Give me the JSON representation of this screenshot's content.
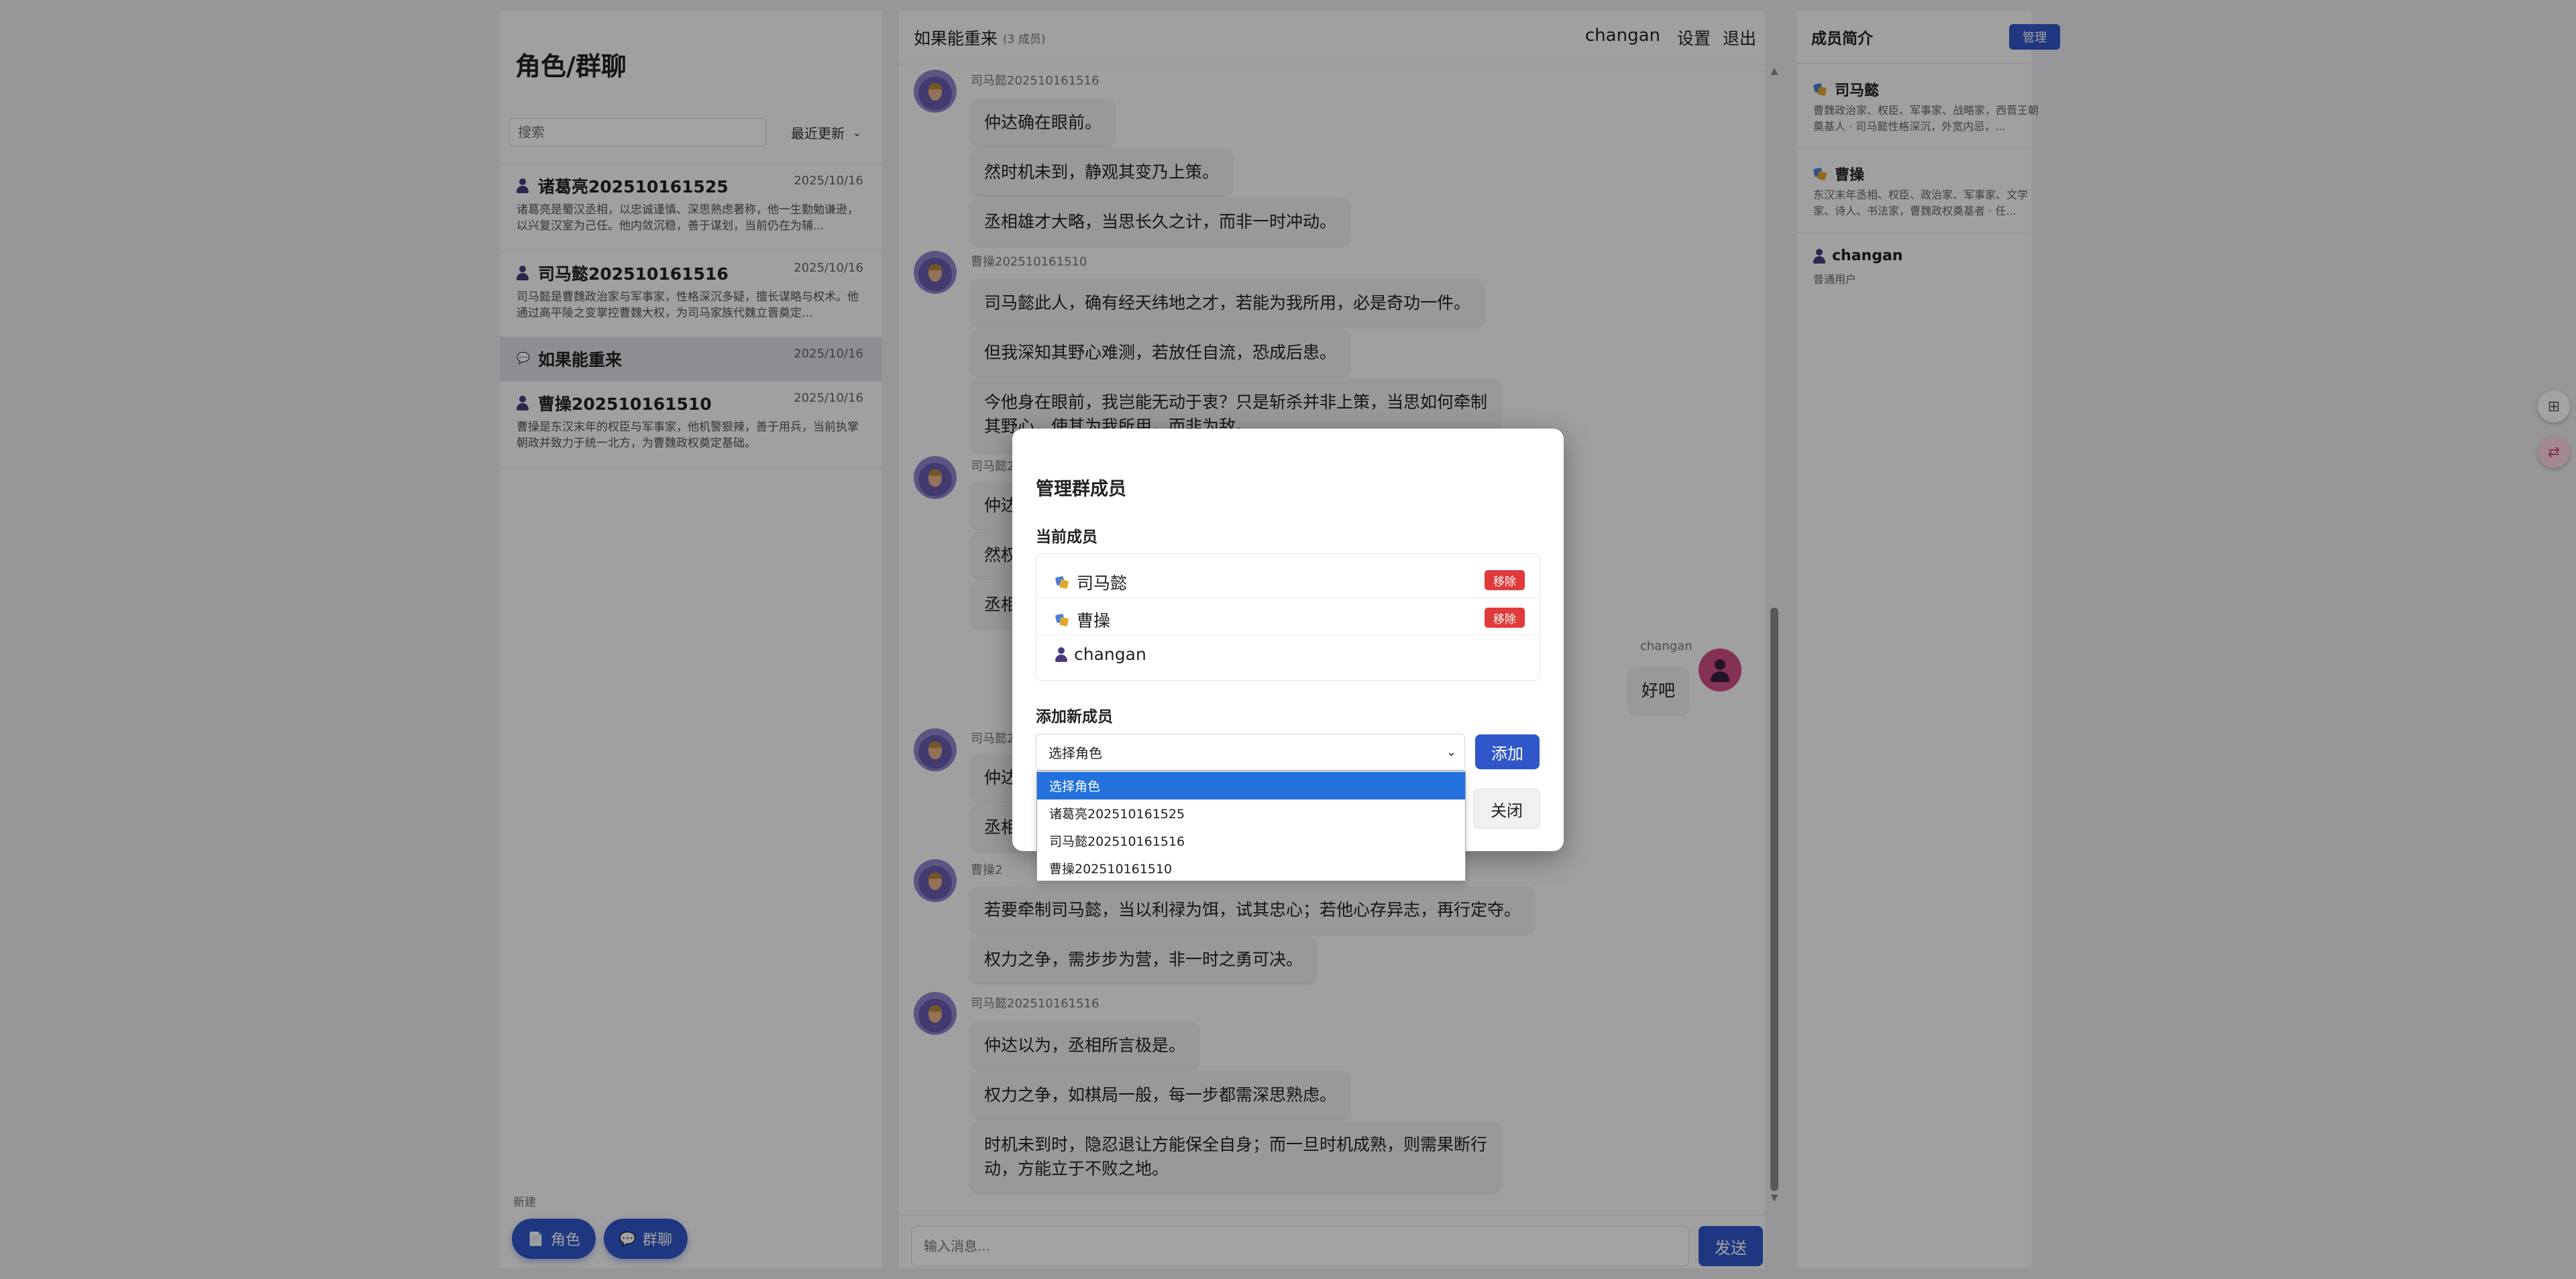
{
  "left_panel": {
    "title": "角色/群聊",
    "search_placeholder": "搜索",
    "sort_label": "最近更新",
    "conversations": [
      {
        "name": "诸葛亮202510161525",
        "date": "2025/10/16",
        "preview": "诸葛亮是蜀汉丞相，以忠诚谨慎、深思熟虑著称，他一生勤勉谦逊，以兴复汉室为己任。他内敛沉稳，善于谋划，当前仍在为辅..."
      },
      {
        "name": "司马懿202510161516",
        "date": "2025/10/16",
        "preview": "司马懿是曹魏政治家与军事家，性格深沉多疑，擅长谋略与权术。他通过高平陵之变掌控曹魏大权，为司马家族代魏立晋奠定..."
      },
      {
        "name": "如果能重来",
        "date": "2025/10/16",
        "preview": ""
      },
      {
        "name": "曹操202510161510",
        "date": "2025/10/16",
        "preview": "曹操是东汉末年的权臣与军事家，他机警狠辣，善于用兵，当前执掌朝政并致力于统一北方，为曹魏政权奠定基础。"
      }
    ],
    "new_label": "新建",
    "new_role_button": "角色",
    "new_group_button": "群聊"
  },
  "chat": {
    "title": "如果能重来",
    "member_count": "(3 成员)",
    "user": "changan",
    "settings": "设置",
    "logout": "退出",
    "messages": [
      {
        "sender": "司马懿202510161516",
        "lines": [
          "仲达确在眼前。",
          "然时机未到，静观其变乃上策。",
          "丞相雄才大略，当思长久之计，而非一时冲动。"
        ]
      },
      {
        "sender": "曹操202510161510",
        "lines": [
          "司马懿此人，确有经天纬地之才，若能为我所用，必是奇功一件。",
          "但我深知其野心难测，若放任自流，恐成后患。",
          "今他身在眼前，我岂能无动于衷？只是斩杀并非上策，当思如何牵制其野心，使其为我所用，而非为敌。"
        ]
      },
      {
        "sender": "司马懿2",
        "lines": [
          "仲达",
          "然权",
          "丞相"
        ]
      },
      {
        "sender": "changan",
        "lines": [
          "好吧"
        ]
      },
      {
        "sender": "司马懿2",
        "lines": [
          "仲达",
          "丞相"
        ]
      },
      {
        "sender": "曹操2",
        "lines": [
          "若要牵制司马懿，当以利禄为饵，试其忠心；若他心存异志，再行定夺。",
          "权力之争，需步步为营，非一时之勇可决。"
        ]
      },
      {
        "sender": "司马懿202510161516",
        "lines": [
          "仲达以为，丞相所言极是。",
          "权力之争，如棋局一般，每一步都需深思熟虑。",
          "时机未到时，隐忍退让方能保全自身；而一旦时机成熟，则需果断行动，方能立于不败之地。"
        ]
      }
    ],
    "input_placeholder": "输入消息...",
    "send": "发送"
  },
  "right_panel": {
    "title": "成员简介",
    "manage": "管理",
    "members": [
      {
        "name": "司马懿",
        "desc": "曹魏政治家、权臣、军事家、战略家，西晋王朝奠基人 · 司马懿性格深沉，外宽内忌，..."
      },
      {
        "name": "曹操",
        "desc": "东汉末年丞相、权臣、政治家、军事家、文学家、诗人、书法家，曹魏政权奠基者 · 任..."
      },
      {
        "name": "changan",
        "desc": "普通用户"
      }
    ]
  },
  "modal": {
    "title": "管理群成员",
    "current_label": "当前成员",
    "members": [
      {
        "name": "司马懿",
        "remove": "移除"
      },
      {
        "name": "曹操",
        "remove": "移除"
      },
      {
        "name": "changan"
      }
    ],
    "add_label": "添加新成员",
    "select_value": "选择角色",
    "add_button": "添加",
    "close_button": "关闭",
    "options": [
      "选择角色",
      "诸葛亮202510161525",
      "司马懿202510161516",
      "曹操202510161510"
    ]
  },
  "colors": {
    "accent": "#2f57c9",
    "danger": "#e03a3a",
    "selected_option": "#2271dd"
  }
}
